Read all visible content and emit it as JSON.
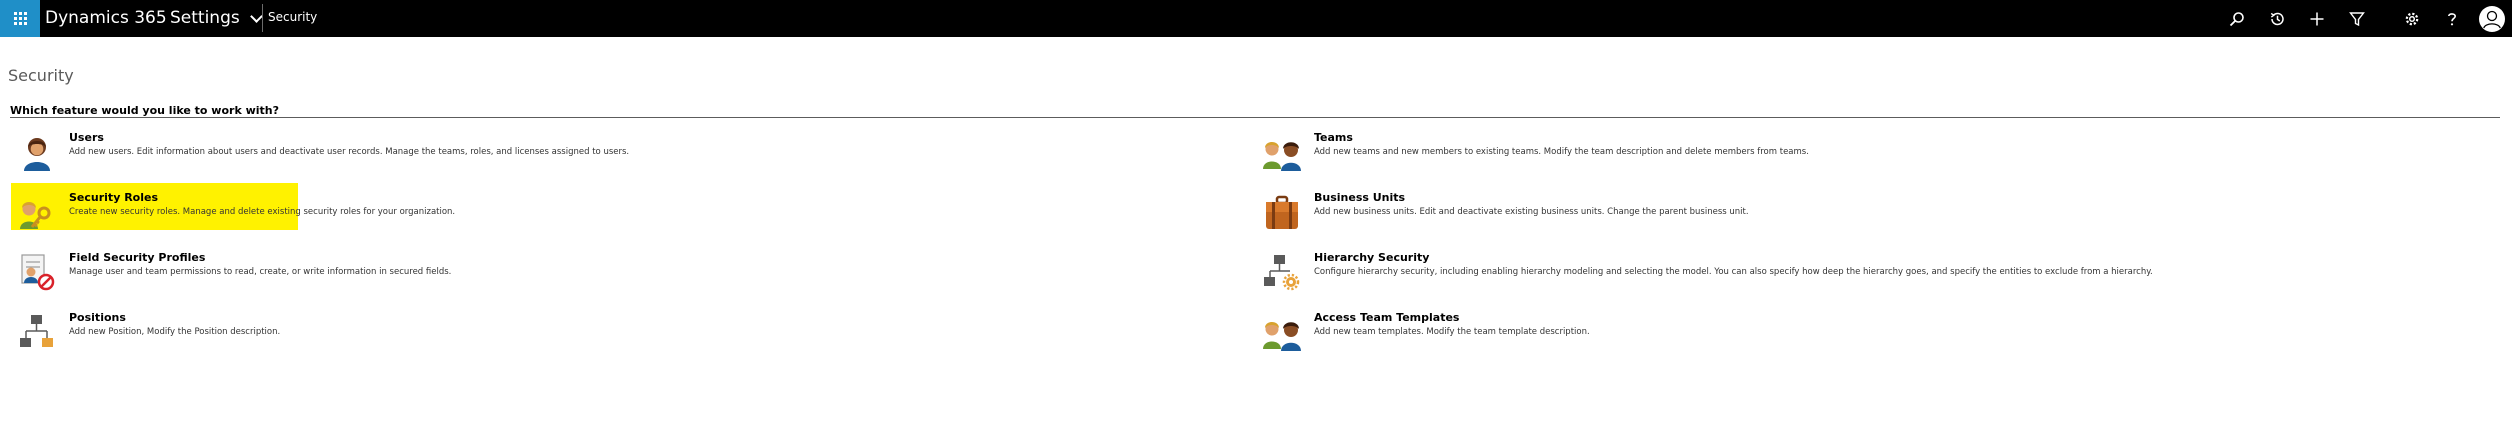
{
  "app": {
    "title": "Dynamics 365",
    "settings_label": "Settings",
    "breadcrumb": "Security"
  },
  "toolbar_icons": [
    "search-icon",
    "recent-icon",
    "add-icon",
    "filter-icon",
    "gear-icon",
    "help-icon",
    "user-avatar-icon"
  ],
  "page": {
    "title": "Security",
    "question": "Which feature would you like to work with?"
  },
  "colors": {
    "topbar": "#000000",
    "waffle": "#1f8fc8",
    "highlight": "#fff200"
  },
  "features": [
    {
      "name": "Users",
      "desc": "Add new users. Edit information about users and deactivate user records. Manage the teams, roles, and licenses assigned to users.",
      "icon": "user-icon"
    },
    {
      "name": "Teams",
      "desc": "Add new teams and new members to existing teams. Modify the team description and delete members from teams.",
      "icon": "teams-icon"
    },
    {
      "name": "Security Roles",
      "desc": "Create new security roles. Manage and delete existing security roles for your organization.",
      "icon": "security-roles-icon",
      "highlighted": true
    },
    {
      "name": "Business Units",
      "desc": "Add new business units. Edit and deactivate existing business units. Change the parent business unit.",
      "icon": "business-units-icon"
    },
    {
      "name": "Field Security Profiles",
      "desc": "Manage user and team permissions to read, create, or write information in secured fields.",
      "icon": "field-security-icon"
    },
    {
      "name": "Hierarchy Security",
      "desc": "Configure hierarchy security, including enabling hierarchy modeling and selecting the model. You can also specify how deep the hierarchy goes, and specify the entities to exclude from a hierarchy.",
      "icon": "hierarchy-icon"
    },
    {
      "name": "Positions",
      "desc": "Add new Position, Modify the Position description.",
      "icon": "positions-icon"
    },
    {
      "name": "Access Team Templates",
      "desc": "Add new team templates. Modify the team template description.",
      "icon": "access-team-templates-icon"
    }
  ]
}
